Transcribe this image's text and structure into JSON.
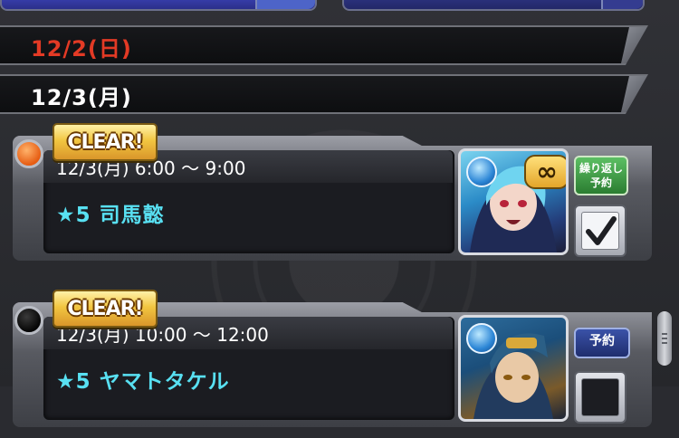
{
  "date_headers": [
    {
      "label": "12/2(日)",
      "color": "#e33a25"
    },
    {
      "label": "12/3(月)",
      "color": "#ffffff"
    }
  ],
  "events": [
    {
      "badge": "CLEAR!",
      "time": "12/3(月) 6:00 〜 9:00",
      "quest": "★5 司馬懿",
      "portrait_icon": "character-portrait-icon",
      "infinity_badge": "∞",
      "action_label_line1": "繰り返し",
      "action_label_line2": "予約",
      "checked": true
    },
    {
      "badge": "CLEAR!",
      "time": "12/3(月) 10:00 〜 12:00",
      "quest": "★5 ヤマトタケル",
      "portrait_icon": "character-portrait-icon",
      "action_label": "予約",
      "checked": false
    }
  ],
  "colors": {
    "past_date": "#e33a25",
    "quest_name": "#58e0f2",
    "clear_badge": "#f2c641",
    "repeat_button": "#3f9f46",
    "reserve_button": "#2b3f8a"
  }
}
